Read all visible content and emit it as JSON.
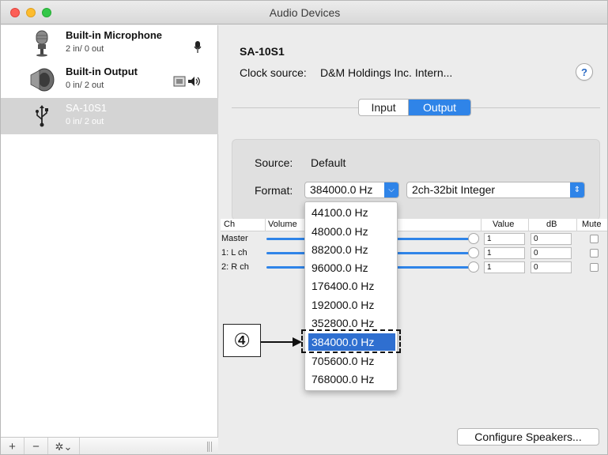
{
  "window": {
    "title": "Audio Devices"
  },
  "sidebar": {
    "devices": [
      {
        "name": "Built-in Microphone",
        "io": "2 in/ 0 out"
      },
      {
        "name": "Built-in Output",
        "io": "0 in/ 2 out"
      },
      {
        "name": "SA-10S1",
        "io": "0 in/ 2 out",
        "selected": true
      }
    ],
    "toolbar": {
      "add": "+",
      "remove": "−",
      "gear": "✲⌄"
    }
  },
  "main": {
    "device_title": "SA-10S1",
    "clock_label": "Clock source:",
    "clock_value": "D&M Holdings Inc. Intern...",
    "help": "?",
    "tabs": [
      {
        "label": "Input"
      },
      {
        "label": "Output",
        "active": true
      }
    ],
    "source_label": "Source:",
    "source_value": "Default",
    "format_label": "Format:",
    "format_rate": "384000.0 Hz",
    "format_bits": "2ch-32bit Integer",
    "table": {
      "headers": {
        "ch": "Ch",
        "volume": "Volume",
        "value": "Value",
        "db": "dB",
        "mute": "Mute"
      },
      "rows": [
        {
          "ch": "Master",
          "value": "1",
          "db": "0"
        },
        {
          "ch": "1: L ch",
          "value": "1",
          "db": "0"
        },
        {
          "ch": "2: R ch",
          "value": "1",
          "db": "0"
        }
      ]
    },
    "configure_button": "Configure Speakers..."
  },
  "menu": {
    "items": [
      "44100.0 Hz",
      "48000.0 Hz",
      "88200.0 Hz",
      "96000.0 Hz",
      "176400.0 Hz",
      "192000.0 Hz",
      "352800.0 Hz",
      "384000.0 Hz",
      "705600.0 Hz",
      "768000.0 Hz"
    ],
    "selected_index": 7
  },
  "callout": {
    "label": "④"
  },
  "colors": {
    "accent": "#2f84e8",
    "selection": "#2f6fd0"
  }
}
